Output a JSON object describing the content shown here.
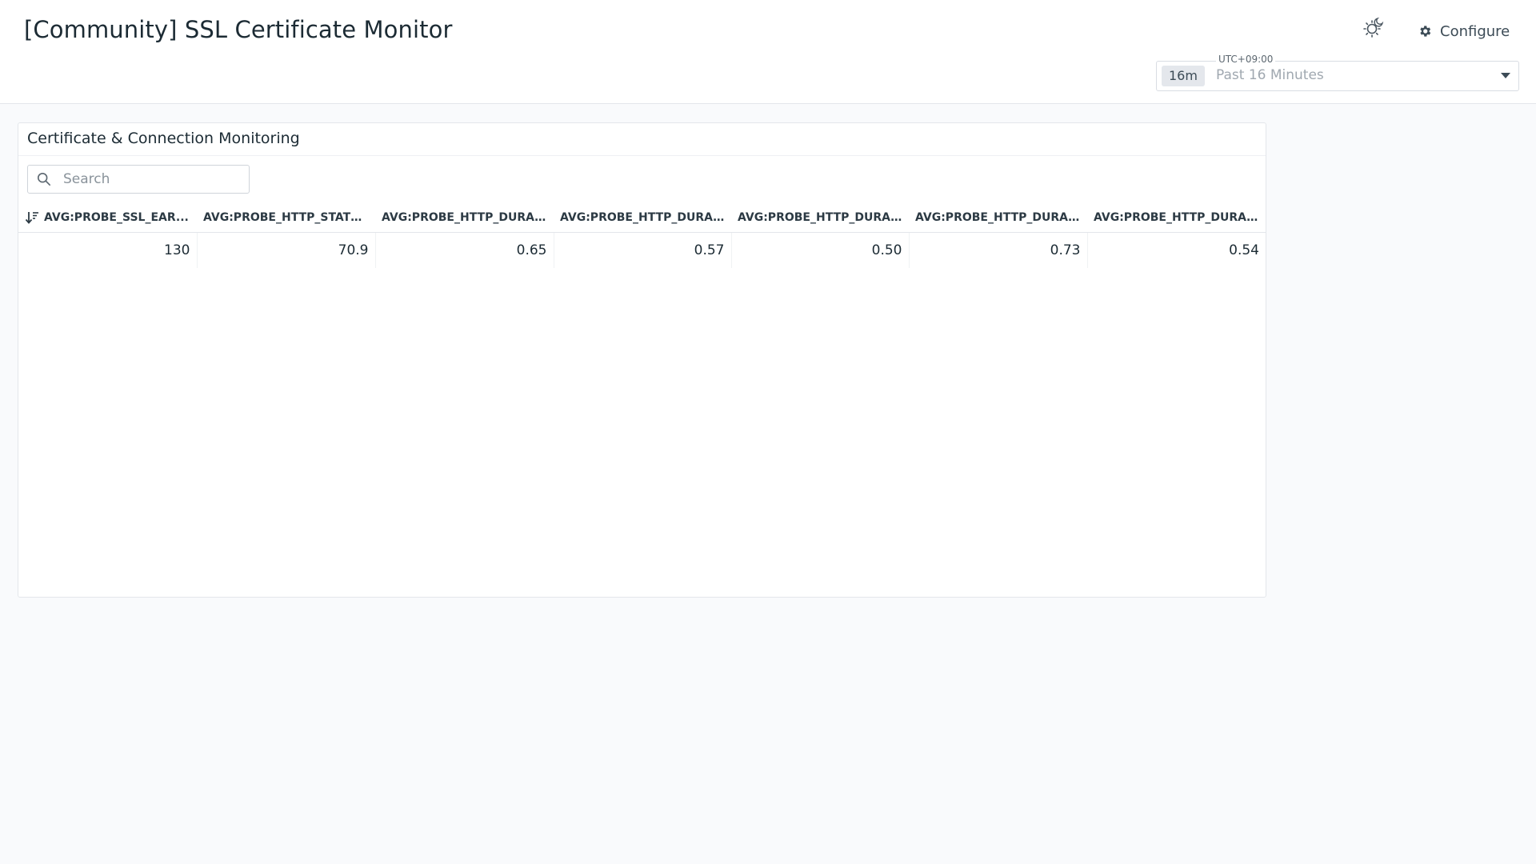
{
  "header": {
    "title": "[Community] SSL Certificate Monitor",
    "configure_label": "Configure",
    "timezone": "UTC+09:00",
    "range_badge": "16m",
    "range_text": "Past 16 Minutes"
  },
  "widget": {
    "title": "Certificate & Connection Monitoring",
    "search_placeholder": "Search",
    "columns": [
      "AVG:PROBE_SSL_EAR...",
      "AVG:PROBE_HTTP_STATU...",
      "AVG:PROBE_HTTP_DURA...",
      "AVG:PROBE_HTTP_DURA...",
      "AVG:PROBE_HTTP_DURA...",
      "AVG:PROBE_HTTP_DURA...",
      "AVG:PROBE_HTTP_DURA..."
    ],
    "rows": [
      [
        "130",
        "70.9",
        "0.65",
        "0.57",
        "0.50",
        "0.73",
        "0.54"
      ]
    ]
  },
  "icons": {
    "theme": "sun-moon-icon",
    "configure": "gear-icon",
    "search": "search-icon",
    "sort": "sort-descending-icon",
    "range": "chevron-down-icon"
  }
}
